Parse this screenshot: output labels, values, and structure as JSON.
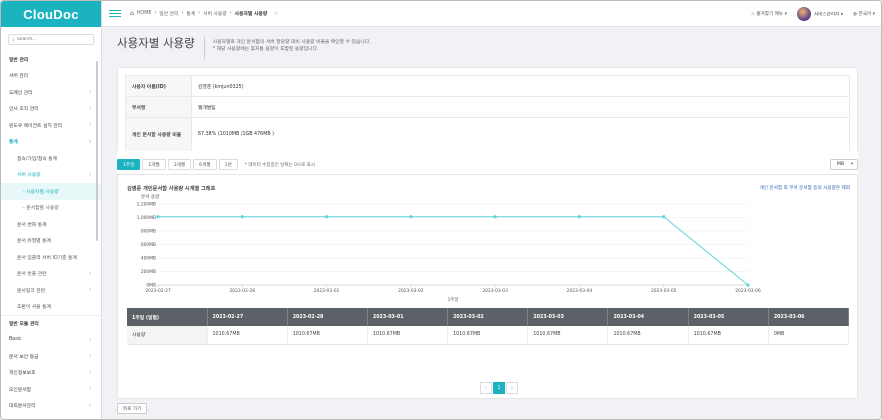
{
  "app": {
    "logo": "ClouDoc"
  },
  "sidebar": {
    "search_placeholder": "Search...",
    "items": [
      {
        "label": "일반 관리",
        "kind": "head"
      },
      {
        "label": "서버 관리",
        "kind": "item"
      },
      {
        "label": "도메인 관리",
        "kind": "item",
        "chevron": true
      },
      {
        "label": "인사 조직 관리",
        "kind": "item",
        "chevron": true
      },
      {
        "label": "윈도우 에이전트 설치 관리",
        "kind": "item",
        "chevron": true
      },
      {
        "label": "통계",
        "kind": "hl",
        "chevron": true
      },
      {
        "label": "접속/가입/접속 통계",
        "kind": "sub"
      },
      {
        "label": "서버 사용량",
        "kind": "sub-hl",
        "chevron": true
      },
      {
        "label": "- 사용자별 사용량",
        "kind": "sub2 active"
      },
      {
        "label": "- 문서함별 사용량",
        "kind": "sub3"
      },
      {
        "label": "문서 변화 통계",
        "kind": "sub"
      },
      {
        "label": "문서 유형별 통계",
        "kind": "sub"
      },
      {
        "label": "문서 입출력 서버 IO기준 통계",
        "kind": "sub"
      },
      {
        "label": "문서 반출 관련",
        "kind": "sub",
        "chevron": true
      },
      {
        "label": "문서링크 관련",
        "kind": "sub",
        "chevron": true
      },
      {
        "label": "조판이 서울 통계",
        "kind": "sub"
      },
      {
        "label": "일반 모듈 관리",
        "kind": "head sep"
      },
      {
        "label": "Basic",
        "kind": "item",
        "chevron": true
      },
      {
        "label": "문서 보안 등급",
        "kind": "item",
        "chevron": true
      },
      {
        "label": "개인정보보호",
        "kind": "item",
        "chevron": true
      },
      {
        "label": "오인문서함",
        "kind": "item",
        "chevron": true
      },
      {
        "label": "대외문서관리",
        "kind": "item",
        "chevron": true
      },
      {
        "label": "키워드 검검",
        "kind": "item",
        "chevron": true
      }
    ]
  },
  "topbar": {
    "breadcrumb": [
      "HOME",
      "일반 관리",
      "통계",
      "서버 사용량",
      "사용자별 사용량"
    ],
    "favorites": "즐겨찾기 메뉴",
    "user": "서버스관리자",
    "language": "한국어"
  },
  "page": {
    "title": "사용자별 사용량",
    "desc_line1": "사용자별로 개인 문서함의 서버 할당량 대비 사용량 비율을 확인할 수 있습니다.",
    "desc_line2": "* 해당 사용량에는 휴지통 용량이 포함된 용량입니다."
  },
  "info": [
    {
      "key": "사용자 이름(ID)",
      "value": "김영준 (kmjun0325)"
    },
    {
      "key": "부서명",
      "value": "웹개발팀"
    },
    {
      "key": "개인 문서함 사용량 비율",
      "value": "67.38% (1010MB /1GB 476MB )"
    }
  ],
  "periods": {
    "buttons": [
      "1주일",
      "1개월",
      "3개월",
      "6개월",
      "1년"
    ],
    "selected": "1주일",
    "note": "* 데이터 수집중인 날짜는 0으로 표시",
    "unit": "MB"
  },
  "chart": {
    "title": "김영준 개인문서함 사용량 시계열 그래프",
    "link": "개인 문서함 외 부서 문서함 등의 사용량은 제외",
    "color": "#5fd4d8"
  },
  "chart_data": {
    "type": "line",
    "ylabel": "문서 용량",
    "xlabel": "1주일",
    "x": [
      "2023-02-27",
      "2023-02-28",
      "2023-03-01",
      "2023-03-02",
      "2023-03-03",
      "2023-03-04",
      "2023-03-05",
      "2023-03-06"
    ],
    "series": [
      {
        "values": [
          1010.67,
          1010.67,
          1010.67,
          1010.67,
          1010.67,
          1010.67,
          1010.67,
          0
        ]
      }
    ],
    "yticks": [
      "1,200MB",
      "1,000MB",
      "800MB",
      "600MB",
      "400MB",
      "200MB",
      "0MB"
    ],
    "ylim": [
      0,
      1200
    ],
    "grid": "y"
  },
  "table": {
    "corner": "1주일 (일별)",
    "headers": [
      "2023-02-27",
      "2023-02-28",
      "2023-03-01",
      "2023-03-02",
      "2023-03-03",
      "2023-03-04",
      "2023-03-05",
      "2023-03-06"
    ],
    "row_label": "사용량",
    "values": [
      "1010.67MB",
      "1010.67MB",
      "1010.67MB",
      "1010.67MB",
      "1010.67MB",
      "1010.67MB",
      "1010.67MB",
      "0MB"
    ]
  },
  "pager": {
    "prev": "‹",
    "current": "1",
    "next": "›"
  },
  "footer": {
    "back": "뒤로 가기"
  }
}
